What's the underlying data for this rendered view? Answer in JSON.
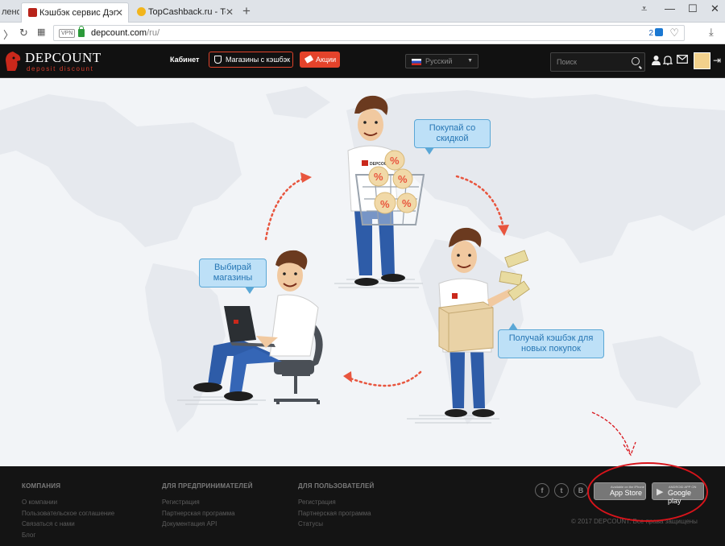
{
  "browser": {
    "tabs": [
      {
        "label": "лено"
      },
      {
        "label": "Кэшбэк сервис Дэпкаунт"
      },
      {
        "label": "TopCashback.ru - Топ луч"
      }
    ],
    "url_host": "depcount.com",
    "url_path": "/ru/",
    "url_badge": "2",
    "vpn_label": "VPN"
  },
  "header": {
    "logo_name": "DEPCOUNT",
    "logo_slogan": "deposit discount",
    "nav_cabinet": "Кабинет",
    "nav_shops": "Магазины с кэшбэк",
    "nav_promo": "Акции",
    "language": "Русский",
    "search_placeholder": "Поиск"
  },
  "hero": {
    "bubble_buy": "Покупай со скидкой",
    "bubble_choose": "Выбирай магазины",
    "bubble_cashback": "Получай кэшбэк для новых покупок",
    "shirt_logo": "DEPCOUNT"
  },
  "footer": {
    "company": {
      "title": "КОМПАНИЯ",
      "links": [
        "О компании",
        "Пользовательское соглашение",
        "Связаться с нами",
        "Блог"
      ]
    },
    "business": {
      "title": "ДЛЯ ПРЕДПРИНИМАТЕЛЕЙ",
      "links": [
        "Регистрация",
        "Партнерская программа",
        "Документация API"
      ]
    },
    "users": {
      "title": "ДЛЯ ПОЛЬЗОВАТЕЛЕЙ",
      "links": [
        "Регистрация",
        "Партнерская программа",
        "Статусы"
      ]
    },
    "social": [
      "f",
      "t",
      "B"
    ],
    "appstore_small": "Available on the iPhone",
    "appstore_big": "App Store",
    "googleplay_small": "ANDROID APP ON",
    "googleplay_big": "Google play",
    "copyright": "© 2017 DEPCOUNT. Все права защищены"
  },
  "colors": {
    "brand_red": "#e4432b",
    "bubble_bg": "#bde0f7",
    "bubble_text": "#2676b4",
    "annotation_red": "#d8141b"
  }
}
